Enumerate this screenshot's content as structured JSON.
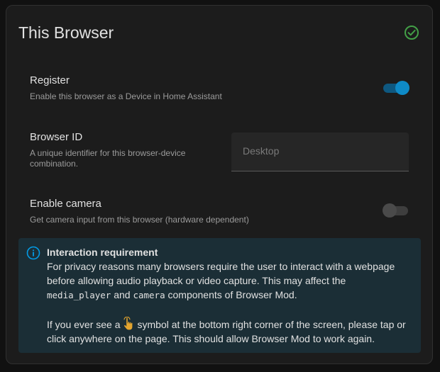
{
  "card": {
    "title": "This Browser",
    "status_icon": "check-circle-icon",
    "status_color": "#43a047"
  },
  "register": {
    "label": "Register",
    "description": "Enable this browser as a Device in Home Assistant",
    "enabled": true
  },
  "browser_id": {
    "label": "Browser ID",
    "description_line1": "A unique identifier for this browser-device",
    "description_line2": "combination.",
    "placeholder": "Desktop",
    "value": ""
  },
  "camera": {
    "label": "Enable camera",
    "description": "Get camera input from this browser (hardware dependent)",
    "enabled": false
  },
  "alert": {
    "icon": "info-icon",
    "title": "Interaction requirement",
    "line1": "For privacy reasons many browsers require the user to interact with a webpage",
    "line2": "before allowing audio playback or video capture. This may affect the",
    "code1": "media_player",
    "and": " and ",
    "code2": "camera",
    "line3_end": " components of Browser Mod.",
    "p2_start": "If you ever see a",
    "p2_icon": "hand-pointer-icon",
    "p2_mid": "symbol at the bottom right corner of the screen, please tap or",
    "p2_end": "click anywhere on the page. This should allow Browser Mod to work again."
  },
  "colors": {
    "accent": "#0e8ac7",
    "info": "#039be5",
    "alert_bg": "#1b2e36"
  }
}
